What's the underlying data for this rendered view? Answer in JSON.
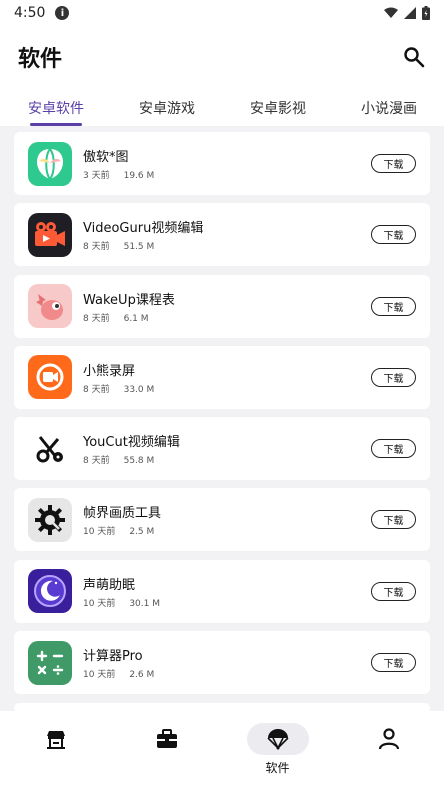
{
  "status": {
    "time": "4:50"
  },
  "header": {
    "title": "软件"
  },
  "tabs": [
    {
      "label": "安卓软件",
      "active": true
    },
    {
      "label": "安卓游戏",
      "active": false
    },
    {
      "label": "安卓影视",
      "active": false
    },
    {
      "label": "小说漫画",
      "active": false
    }
  ],
  "apps": [
    {
      "name": "傲软*图",
      "age": "3 天前",
      "size": "19.6 M",
      "download": "下载",
      "icon": "ao-soft-icon"
    },
    {
      "name": "VideoGuru视频编辑",
      "age": "8 天前",
      "size": "51.5 M",
      "download": "下载",
      "icon": "videoguru-icon"
    },
    {
      "name": "WakeUp课程表",
      "age": "8 天前",
      "size": "6.1 M",
      "download": "下载",
      "icon": "wakeup-icon"
    },
    {
      "name": "小熊录屏",
      "age": "8 天前",
      "size": "33.0 M",
      "download": "下载",
      "icon": "xiaoxiong-icon"
    },
    {
      "name": "YouCut视频编辑",
      "age": "8 天前",
      "size": "55.8 M",
      "download": "下载",
      "icon": "youcut-icon"
    },
    {
      "name": "帧界画质工具",
      "age": "10 天前",
      "size": "2.5 M",
      "download": "下载",
      "icon": "gear-icon"
    },
    {
      "name": "声萌助眠",
      "age": "10 天前",
      "size": "30.1 M",
      "download": "下载",
      "icon": "moon-icon"
    },
    {
      "name": "计算器Pro",
      "age": "10 天前",
      "size": "2.6 M",
      "download": "下载",
      "icon": "calculator-icon"
    }
  ],
  "nav": [
    {
      "icon": "store-icon",
      "label": ""
    },
    {
      "icon": "briefcase-icon",
      "label": ""
    },
    {
      "icon": "parachute-icon",
      "label": "软件",
      "active": true
    },
    {
      "icon": "person-icon",
      "label": ""
    }
  ]
}
